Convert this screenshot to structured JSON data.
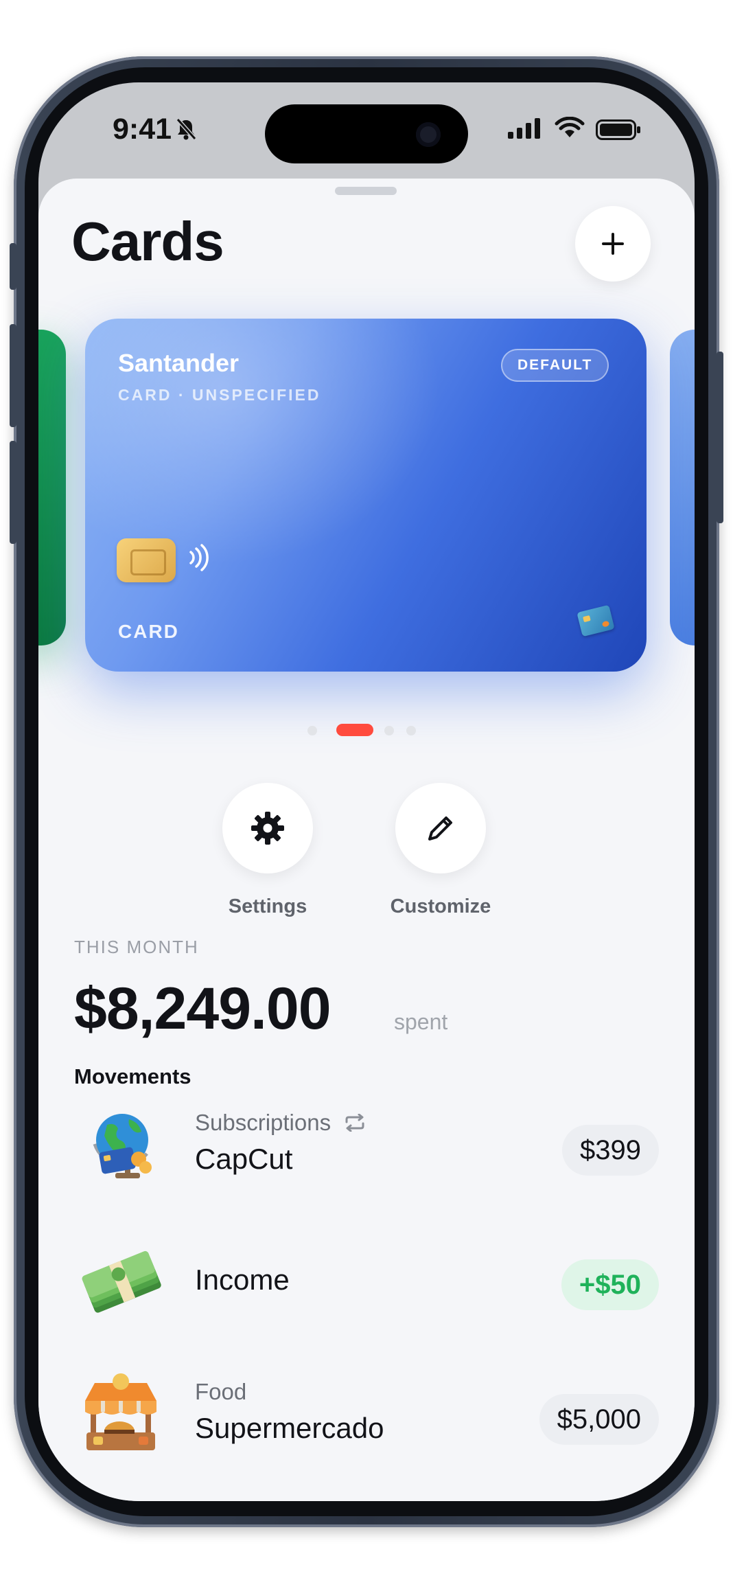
{
  "status_bar": {
    "time": "9:41",
    "icons": [
      "bell-slash-icon",
      "cellular-signal-icon",
      "wifi-icon",
      "battery-icon"
    ]
  },
  "header": {
    "title": "Cards",
    "add_icon": "plus-icon"
  },
  "card": {
    "bank": "Santander",
    "subtitle": "CARD · UNSPECIFIED",
    "badge": "DEFAULT",
    "label": "CARD",
    "gradient_start": "#8fb6f5",
    "gradient_end": "#1f46b8"
  },
  "pager": {
    "count": 4,
    "active_index": 1,
    "active_color": "#ff4b3e"
  },
  "actions": [
    {
      "label": "Settings",
      "icon": "gear-icon"
    },
    {
      "label": "Customize",
      "icon": "pencil-icon"
    }
  ],
  "summary": {
    "period_label": "THIS MONTH",
    "amount": "$8,249.00",
    "suffix": "spent"
  },
  "movements": {
    "title": "Movements",
    "items": [
      {
        "category": "Subscriptions",
        "recurring_icon": "repeat-icon",
        "name": "CapCut",
        "amount": "$399",
        "icon": "globe-card-icon"
      },
      {
        "category": "",
        "name": "Income",
        "amount": "+$50",
        "icon": "money-stack-icon"
      },
      {
        "category": "Food",
        "name": "Supermercado",
        "amount": "$5,000",
        "icon": "market-stall-icon"
      }
    ]
  },
  "colors": {
    "positive": "#1fb25a",
    "accent": "#ff4b3e",
    "background": "#f5f6f9"
  }
}
